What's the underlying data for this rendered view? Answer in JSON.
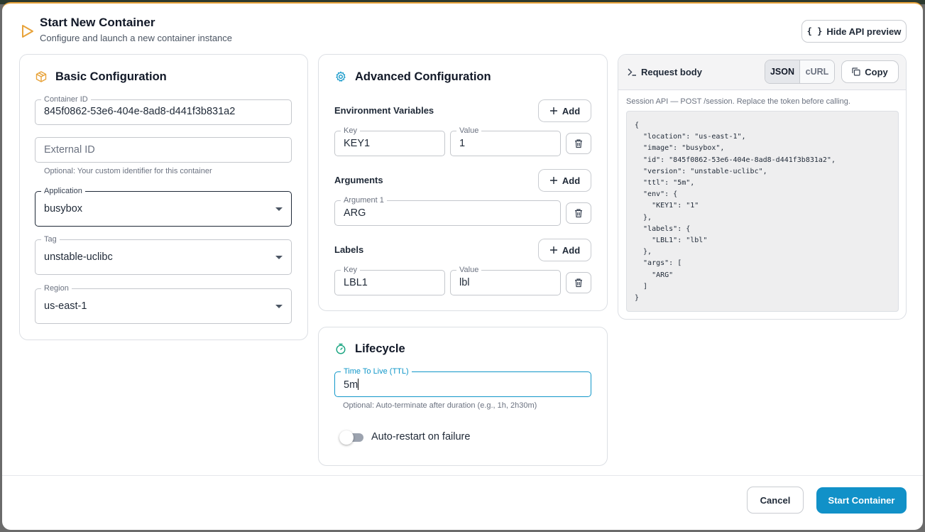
{
  "header": {
    "title": "Start New Container",
    "subtitle": "Configure and launch a new container instance",
    "hide_api_label": "Hide API preview",
    "braces_glyph": "{ }"
  },
  "basic": {
    "title": "Basic Configuration",
    "container_id": {
      "label": "Container ID",
      "value": "845f0862-53e6-404e-8ad8-d441f3b831a2"
    },
    "external_id": {
      "placeholder": "External ID",
      "helper": "Optional: Your custom identifier for this container"
    },
    "application": {
      "label": "Application",
      "value": "busybox"
    },
    "tag": {
      "label": "Tag",
      "value": "unstable-uclibc"
    },
    "region": {
      "label": "Region",
      "value": "us-east-1"
    }
  },
  "advanced": {
    "title": "Advanced Configuration",
    "env": {
      "label": "Environment Variables",
      "add_label": "Add",
      "key_label": "Key",
      "key_value": "KEY1",
      "value_label": "Value",
      "value_value": "1"
    },
    "args": {
      "label": "Arguments",
      "add_label": "Add",
      "arg_label": "Argument 1",
      "arg_value": "ARG"
    },
    "labels": {
      "label": "Labels",
      "add_label": "Add",
      "key_label": "Key",
      "key_value": "LBL1",
      "value_label": "Value",
      "value_value": "lbl"
    }
  },
  "lifecycle": {
    "title": "Lifecycle",
    "ttl": {
      "label": "Time To Live (TTL)",
      "value": "5m",
      "helper": "Optional: Auto-terminate after duration (e.g., 1h, 2h30m)"
    },
    "auto_restart": {
      "label": "Auto-restart on failure",
      "enabled": false
    }
  },
  "request": {
    "title": "Request body",
    "tab_json": "JSON",
    "tab_curl": "cURL",
    "active_tab": "JSON",
    "copy_label": "Copy",
    "note": "Session API — POST /session. Replace the token before calling.",
    "body": "{\n  \"location\": \"us-east-1\",\n  \"image\": \"busybox\",\n  \"id\": \"845f0862-53e6-404e-8ad8-d441f3b831a2\",\n  \"version\": \"unstable-uclibc\",\n  \"ttl\": \"5m\",\n  \"env\": {\n    \"KEY1\": \"1\"\n  },\n  \"labels\": {\n    \"LBL1\": \"lbl\"\n  },\n  \"args\": [\n    \"ARG\"\n  ]\n}"
  },
  "footer": {
    "cancel_label": "Cancel",
    "start_label": "Start Container"
  },
  "colors": {
    "primary": "#1191c8",
    "accent": "#e8a33a",
    "focus": "#1197c9",
    "lifecycle_icon": "#16a37f"
  }
}
